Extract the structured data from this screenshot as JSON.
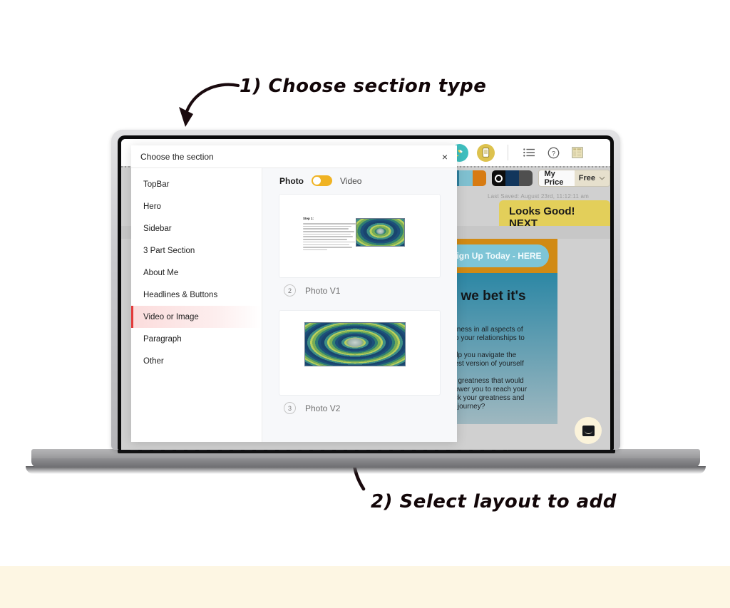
{
  "page": {
    "background_color": "#ffffff",
    "bottom_band_color": "#fdf6e3"
  },
  "annotations": [
    {
      "id": "step-1",
      "text": "1) Choose section type"
    },
    {
      "id": "step-2",
      "text": "2) Select layout to add"
    }
  ],
  "modal": {
    "title": "Choose the section",
    "close_label": "×",
    "sidebar": {
      "items": [
        {
          "label": "TopBar",
          "active": false
        },
        {
          "label": "Hero",
          "active": false
        },
        {
          "label": "Sidebar",
          "active": false
        },
        {
          "label": "3 Part Section",
          "active": false
        },
        {
          "label": "About Me",
          "active": false
        },
        {
          "label": "Headlines & Buttons",
          "active": false
        },
        {
          "label": "Video or Image",
          "active": true
        },
        {
          "label": "Paragraph",
          "active": false
        },
        {
          "label": "Other",
          "active": false
        }
      ],
      "active_highlight_color": "#fbdcdc",
      "active_accent_color": "#e23a3a"
    },
    "toggle": {
      "left_label": "Photo",
      "right_label": "Video",
      "selected": "Photo",
      "track_color": "#f0b323"
    },
    "layouts": [
      {
        "number": "2",
        "label": "Photo V1",
        "thumb_step_title": "Step 1:"
      },
      {
        "number": "3",
        "label": "Photo V2"
      }
    ]
  },
  "app": {
    "toolbar": {
      "paint_icon": "paintbrush-icon",
      "device_icon": "mobile-preview-icon",
      "list_icon": "list-icon",
      "help_icon": "help-icon",
      "grid_icon": "templates-icon"
    },
    "palette_left": [
      "#2f7f9e",
      "#7fc0d0",
      "#d77b12"
    ],
    "palette_right": [
      "#0d0d0d",
      "#12365c",
      "#4f4f4f"
    ],
    "price": {
      "label": "My Price",
      "value": "Free"
    },
    "last_saved": "Last Saved: August 23rd, 11:12:11 am",
    "next_button": "Looks Good! NEXT",
    "hero": {
      "signup_button": "Sign Up Today - HERE",
      "heading": "re, we bet it's",
      "paragraphs": [
        "greatness in all aspects of",
        "eer to your relationships to",
        "to help you navigate the",
        "he best version of yourself",
        "ok to greatness that would",
        "empower you to reach your",
        "unlock your greatness and",
        "ative journey?"
      ]
    },
    "chat_icon": "chat-bubble-icon"
  }
}
